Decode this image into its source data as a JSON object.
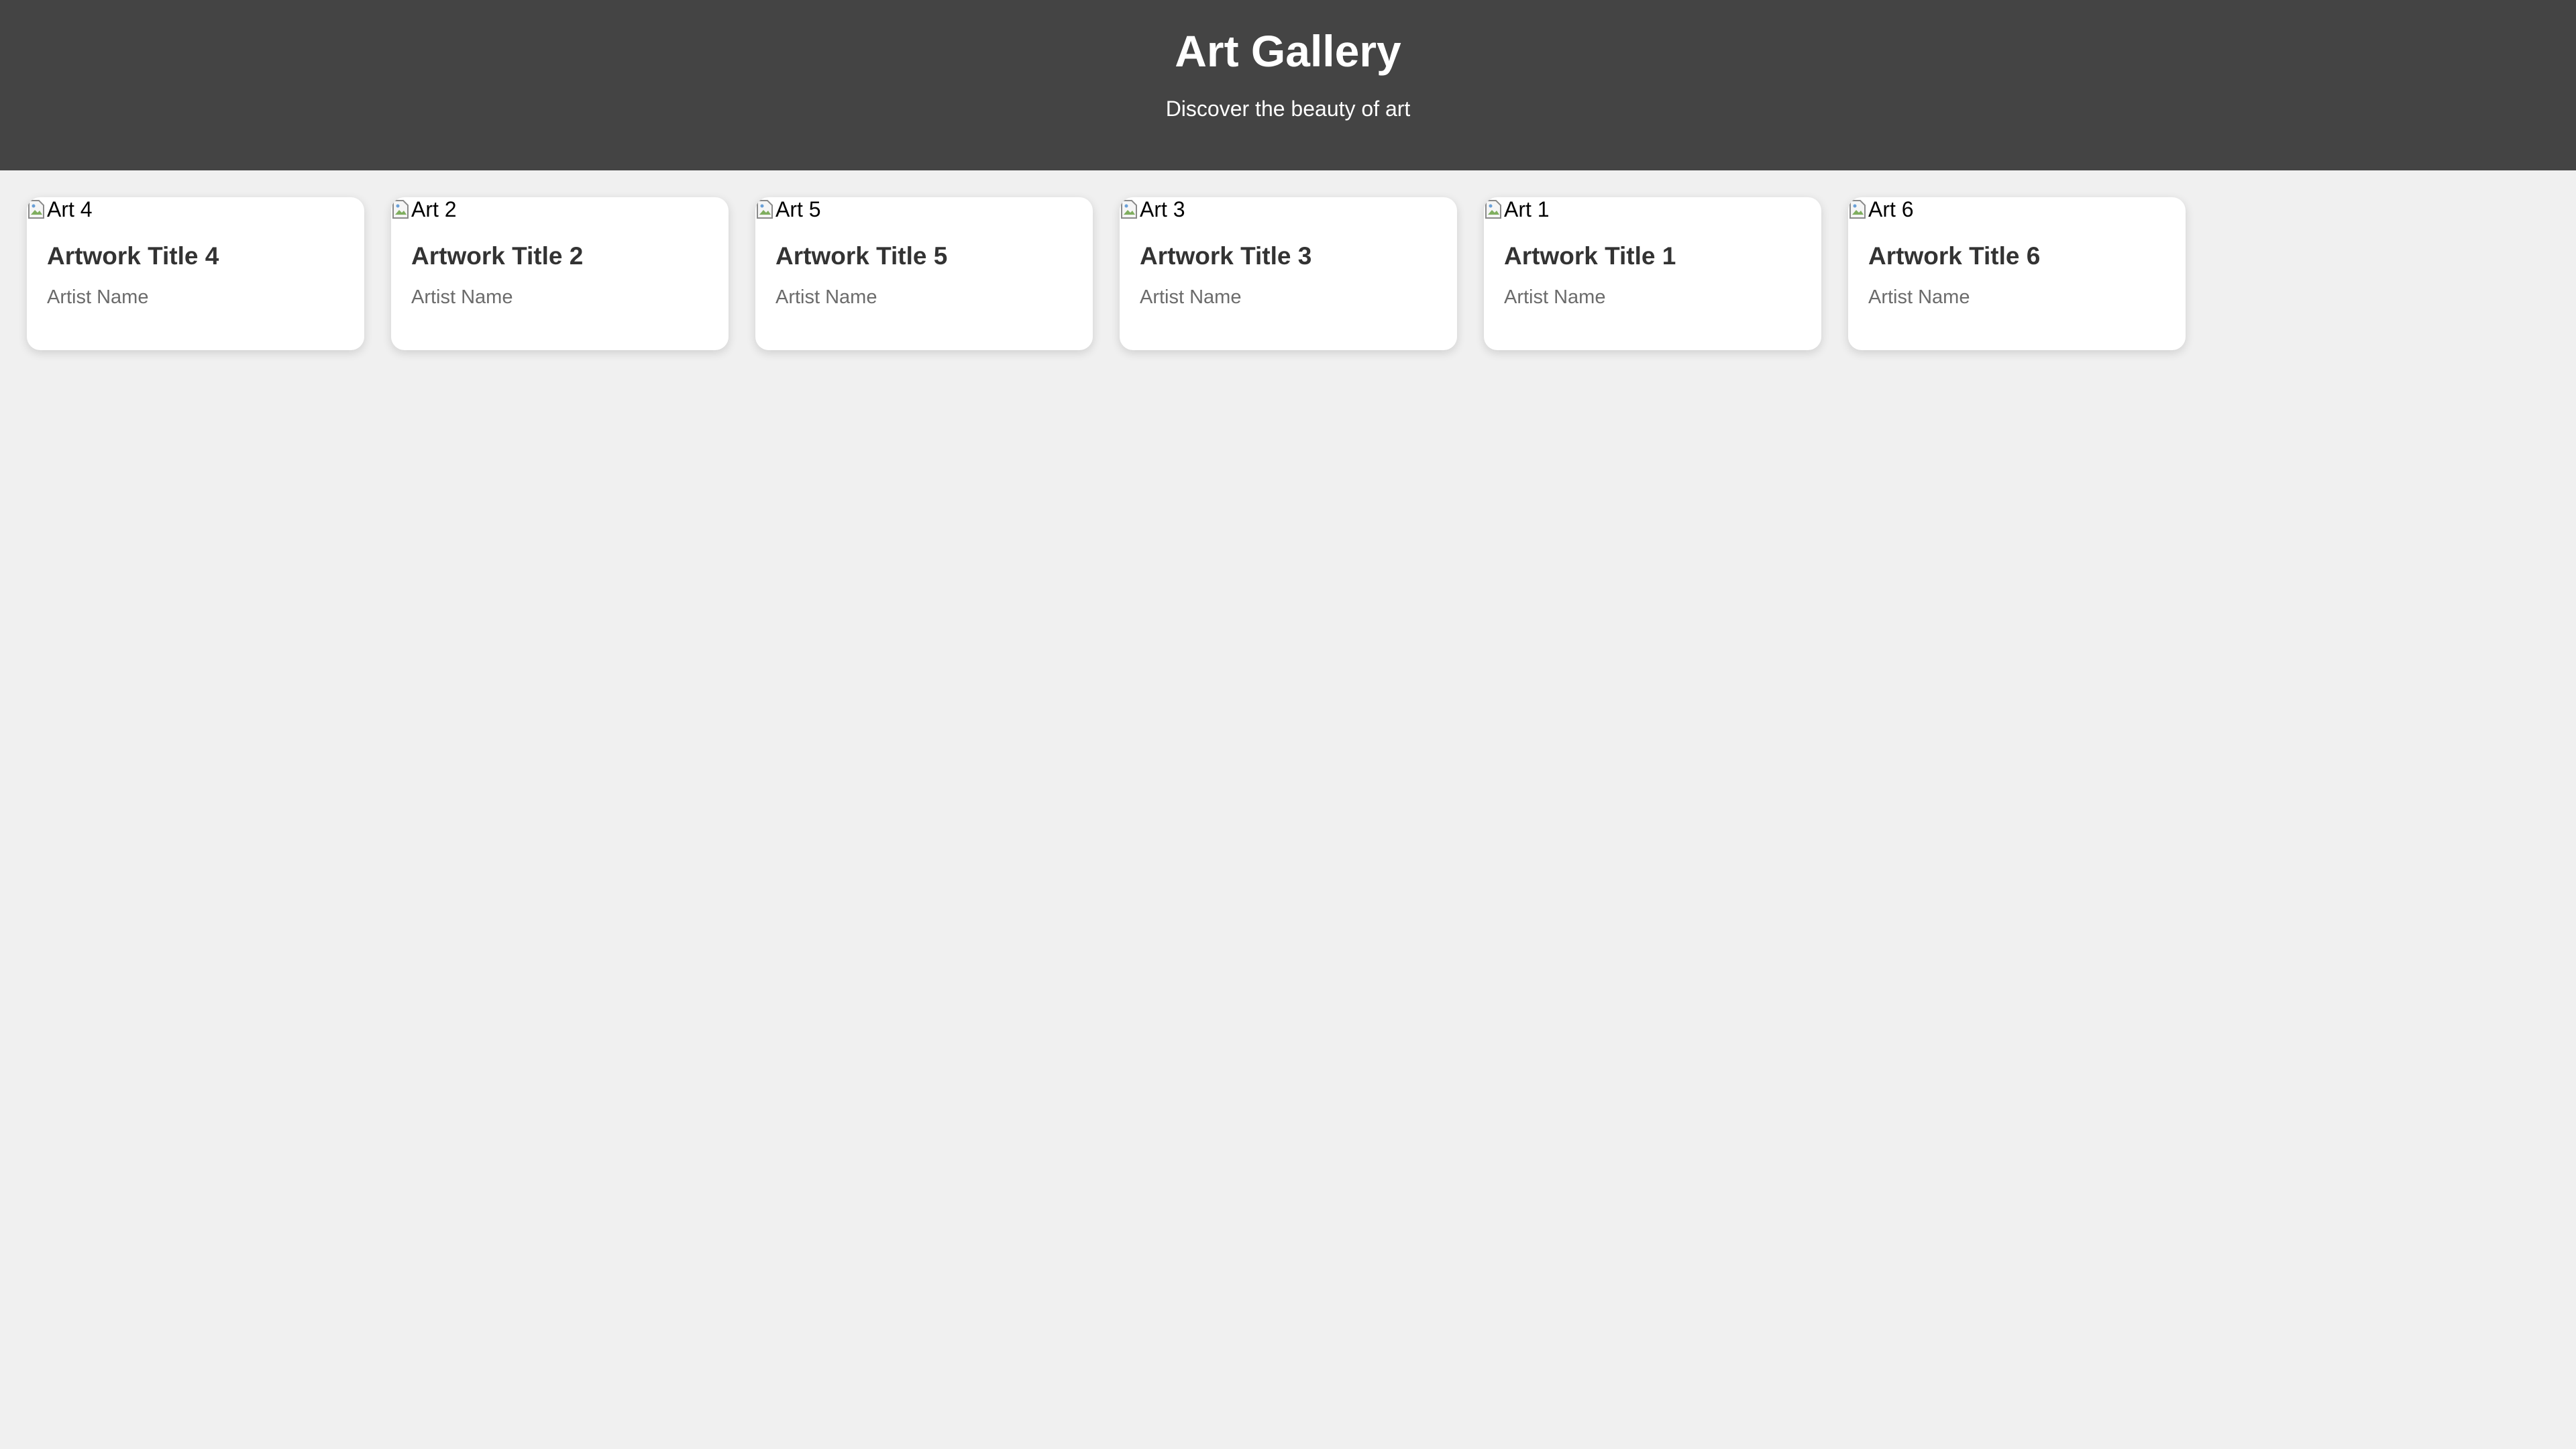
{
  "header": {
    "title": "Art Gallery",
    "subtitle": "Discover the beauty of art",
    "background": "#444444"
  },
  "gallery": {
    "cards": [
      {
        "image_alt": "Art 4",
        "title": "Artwork Title 4",
        "artist": "Artist Name"
      },
      {
        "image_alt": "Art 2",
        "title": "Artwork Title 2",
        "artist": "Artist Name"
      },
      {
        "image_alt": "Art 5",
        "title": "Artwork Title 5",
        "artist": "Artist Name"
      },
      {
        "image_alt": "Art 3",
        "title": "Artwork Title 3",
        "artist": "Artist Name"
      },
      {
        "image_alt": "Art 1",
        "title": "Artwork Title 1",
        "artist": "Artist Name"
      },
      {
        "image_alt": "Art 6",
        "title": "Artwork Title 6",
        "artist": "Artist Name"
      }
    ]
  },
  "colors": {
    "page_background": "#f0f0f0",
    "card_background": "#ffffff",
    "title_text": "#333333",
    "artist_text": "#6b6b6b"
  }
}
